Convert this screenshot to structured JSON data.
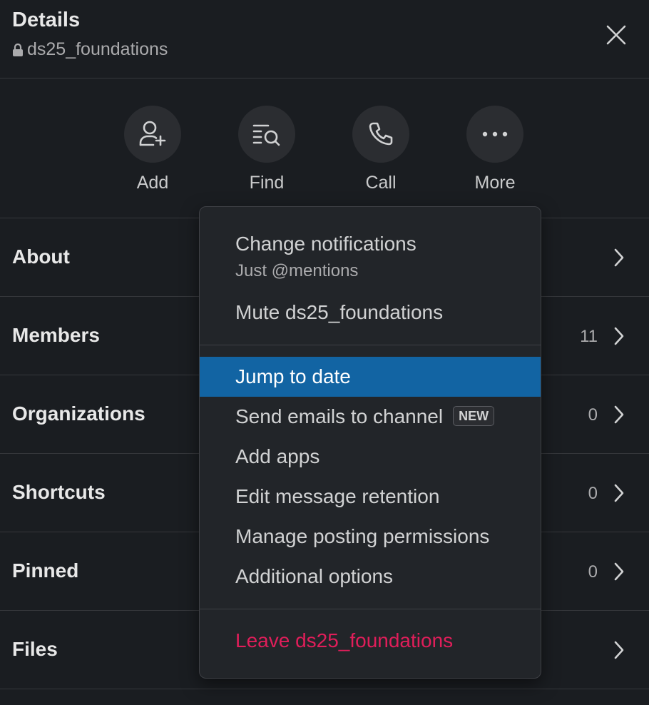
{
  "header": {
    "title": "Details",
    "channel": "ds25_foundations"
  },
  "actions": [
    {
      "label": "Add",
      "icon": "add-user-icon"
    },
    {
      "label": "Find",
      "icon": "search-list-icon"
    },
    {
      "label": "Call",
      "icon": "phone-icon"
    },
    {
      "label": "More",
      "icon": "more-horizontal-icon"
    }
  ],
  "rows": [
    {
      "label": "About",
      "count": ""
    },
    {
      "label": "Members",
      "count": "11"
    },
    {
      "label": "Organizations",
      "count": "0"
    },
    {
      "label": "Shortcuts",
      "count": "0"
    },
    {
      "label": "Pinned",
      "count": "0"
    },
    {
      "label": "Files",
      "count": ""
    }
  ],
  "menu": {
    "change_notifications": "Change notifications",
    "notifications_value": "Just @mentions",
    "mute": "Mute ds25_foundations",
    "jump_to_date": "Jump to date",
    "send_emails": "Send emails to channel",
    "new_badge": "NEW",
    "add_apps": "Add apps",
    "edit_retention": "Edit message retention",
    "manage_posting": "Manage posting permissions",
    "additional_options": "Additional options",
    "leave": "Leave ds25_foundations"
  },
  "colors": {
    "background": "#1a1d21",
    "menu_background": "#222529",
    "highlight": "#1264a3",
    "danger": "#e01e5a"
  }
}
